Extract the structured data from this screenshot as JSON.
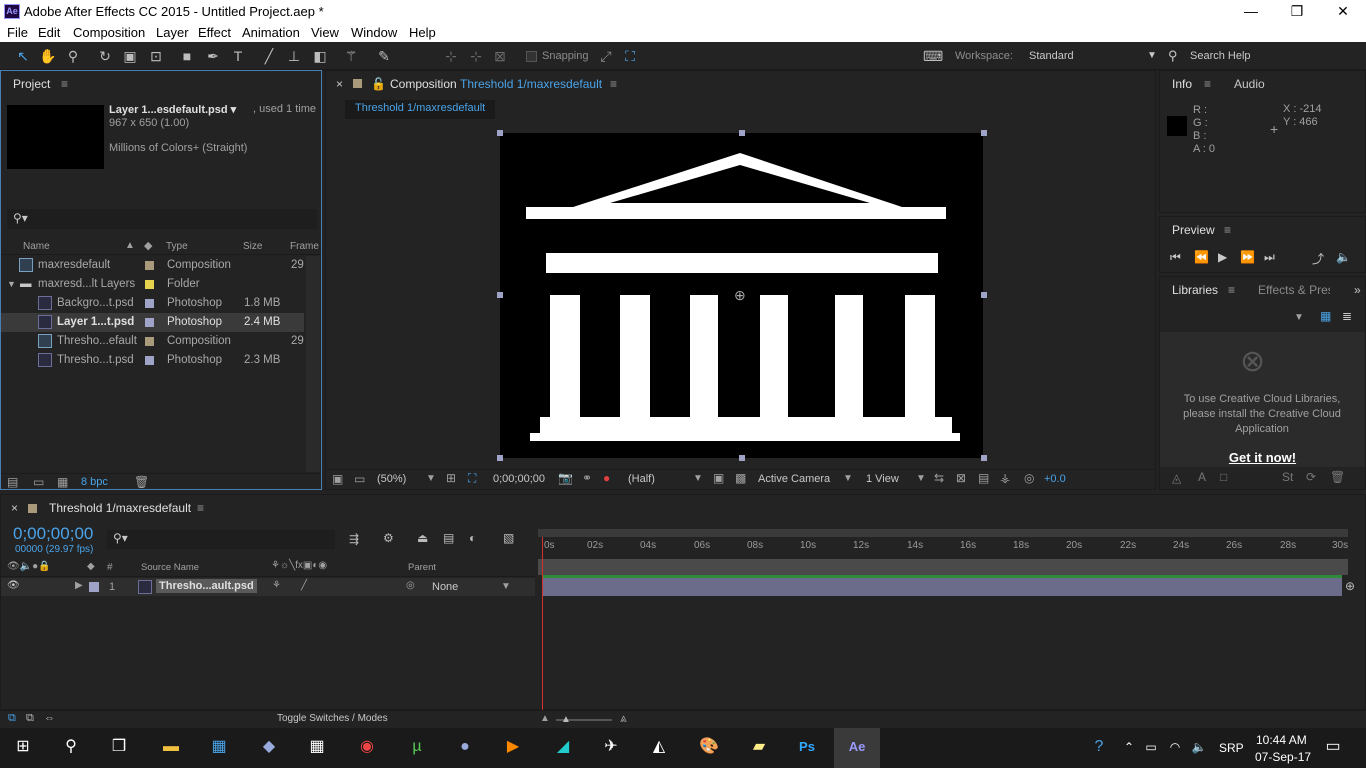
{
  "app": {
    "title": "Adobe After Effects CC 2015 - Untitled Project.aep *",
    "logo": "Ae"
  },
  "window_controls": {
    "minimize": "—",
    "maximize": "❐",
    "close": "✕"
  },
  "menu": [
    "File",
    "Edit",
    "Composition",
    "Layer",
    "Effect",
    "Animation",
    "View",
    "Window",
    "Help"
  ],
  "toolbar": {
    "snapping_label": "Snapping",
    "workspace_label": "Workspace:",
    "workspace_value": "Standard",
    "search_help": "Search Help"
  },
  "project": {
    "tab": "Project",
    "selected_name": "Layer 1...esdefault.psd ▾",
    "used": ", used 1 time",
    "dims": "967 x 650 (1.00)",
    "colors": "Millions of Colors+ (Straight)",
    "search_placeholder": "",
    "columns": {
      "name": "Name",
      "type": "Type",
      "size": "Size",
      "frame": "Frame"
    },
    "items": [
      {
        "name": "maxresdefault",
        "type": "Composition",
        "size": "",
        "frame": "29",
        "swatch": "#a89a7a"
      },
      {
        "name": "maxresd...lt Layers",
        "type": "Folder",
        "size": "",
        "frame": "",
        "swatch": "#e6d24c"
      },
      {
        "name": "Backgro...t.psd",
        "type": "Photoshop",
        "size": "1.8 MB",
        "frame": "",
        "swatch": "#9ea3c7"
      },
      {
        "name": "Layer 1...t.psd",
        "type": "Photoshop",
        "size": "2.4 MB",
        "frame": "",
        "swatch": "#9ea3c7"
      },
      {
        "name": "Thresho...efault",
        "type": "Composition",
        "size": "",
        "frame": "29",
        "swatch": "#a89a7a"
      },
      {
        "name": "Thresho...t.psd",
        "type": "Photoshop",
        "size": "2.3 MB",
        "frame": "",
        "swatch": "#9ea3c7"
      }
    ],
    "bpc": "8 bpc"
  },
  "composition": {
    "tab_prefix": "Composition",
    "tab_name": "Threshold 1/maxresdefault",
    "subtab": "Threshold 1/maxresdefault",
    "zoom": "(50%)",
    "timecode": "0;00;00;00",
    "resolution": "(Half)",
    "camera": "Active Camera",
    "views": "1 View",
    "exposure": "+0.0"
  },
  "info": {
    "tab": "Info",
    "tab2": "Audio",
    "r": "R :",
    "g": "G :",
    "b": "B :",
    "a": "A : 0",
    "x": "X : -214",
    "y": "Y : 466"
  },
  "preview": {
    "tab": "Preview"
  },
  "libraries": {
    "tab": "Libraries",
    "tab2": "Effects & Pres",
    "message": "To use Creative Cloud Libraries, please install the Creative Cloud Application",
    "cta": "Get it now!"
  },
  "timeline": {
    "tab": "Threshold 1/maxresdefault",
    "timecode": "0;00;00;00",
    "frames": "00000 (29.97 fps)",
    "col_source": "Source Name",
    "col_parent": "Parent",
    "layer_index": "1",
    "layer_name": "Thresho...ault.psd",
    "parent_value": "None",
    "ticks": [
      "0s",
      "02s",
      "04s",
      "06s",
      "08s",
      "10s",
      "12s",
      "14s",
      "16s",
      "18s",
      "20s",
      "22s",
      "24s",
      "26s",
      "28s",
      "30s"
    ],
    "toggle": "Toggle Switches / Modes"
  },
  "taskbar": {
    "lang": "SRP",
    "time": "10:44 AM",
    "date": "07-Sep-17",
    "ps": "Ps",
    "ae": "Ae"
  }
}
